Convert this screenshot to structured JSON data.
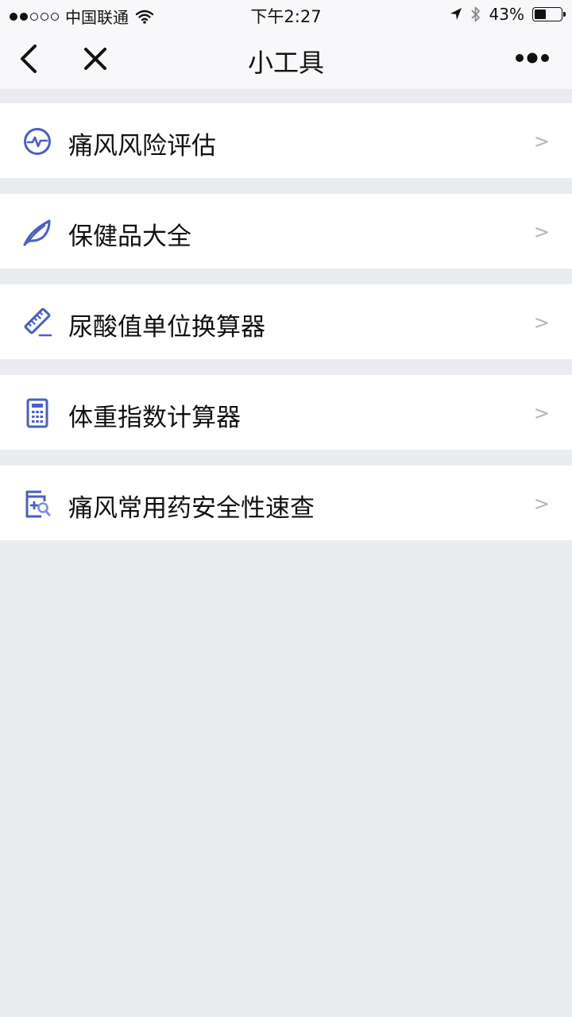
{
  "status_bar": {
    "carrier": "中国联通",
    "time": "下午2:27",
    "battery_percent": "43%",
    "battery_level": 0.43,
    "signal_bars_on": 2,
    "signal_bars_total": 5
  },
  "nav": {
    "title": "小工具",
    "back_icon": "back-chevron-icon",
    "close_icon": "close-icon",
    "more_icon": "more-icon"
  },
  "tools": [
    {
      "label": "痛风风险评估",
      "icon": "pulse-gauge-icon",
      "chevron": ">"
    },
    {
      "label": "保健品大全",
      "icon": "leaf-icon",
      "chevron": ">"
    },
    {
      "label": "尿酸值单位换算器",
      "icon": "ruler-icon",
      "chevron": ">"
    },
    {
      "label": "体重指数计算器",
      "icon": "calculator-icon",
      "chevron": ">"
    },
    {
      "label": "痛风常用药安全性速查",
      "icon": "medicine-search-icon",
      "chevron": ">"
    }
  ],
  "colors": {
    "accent": "#4a5ec9",
    "background": "#ebecf0",
    "chevron": "#b3b3b8"
  }
}
